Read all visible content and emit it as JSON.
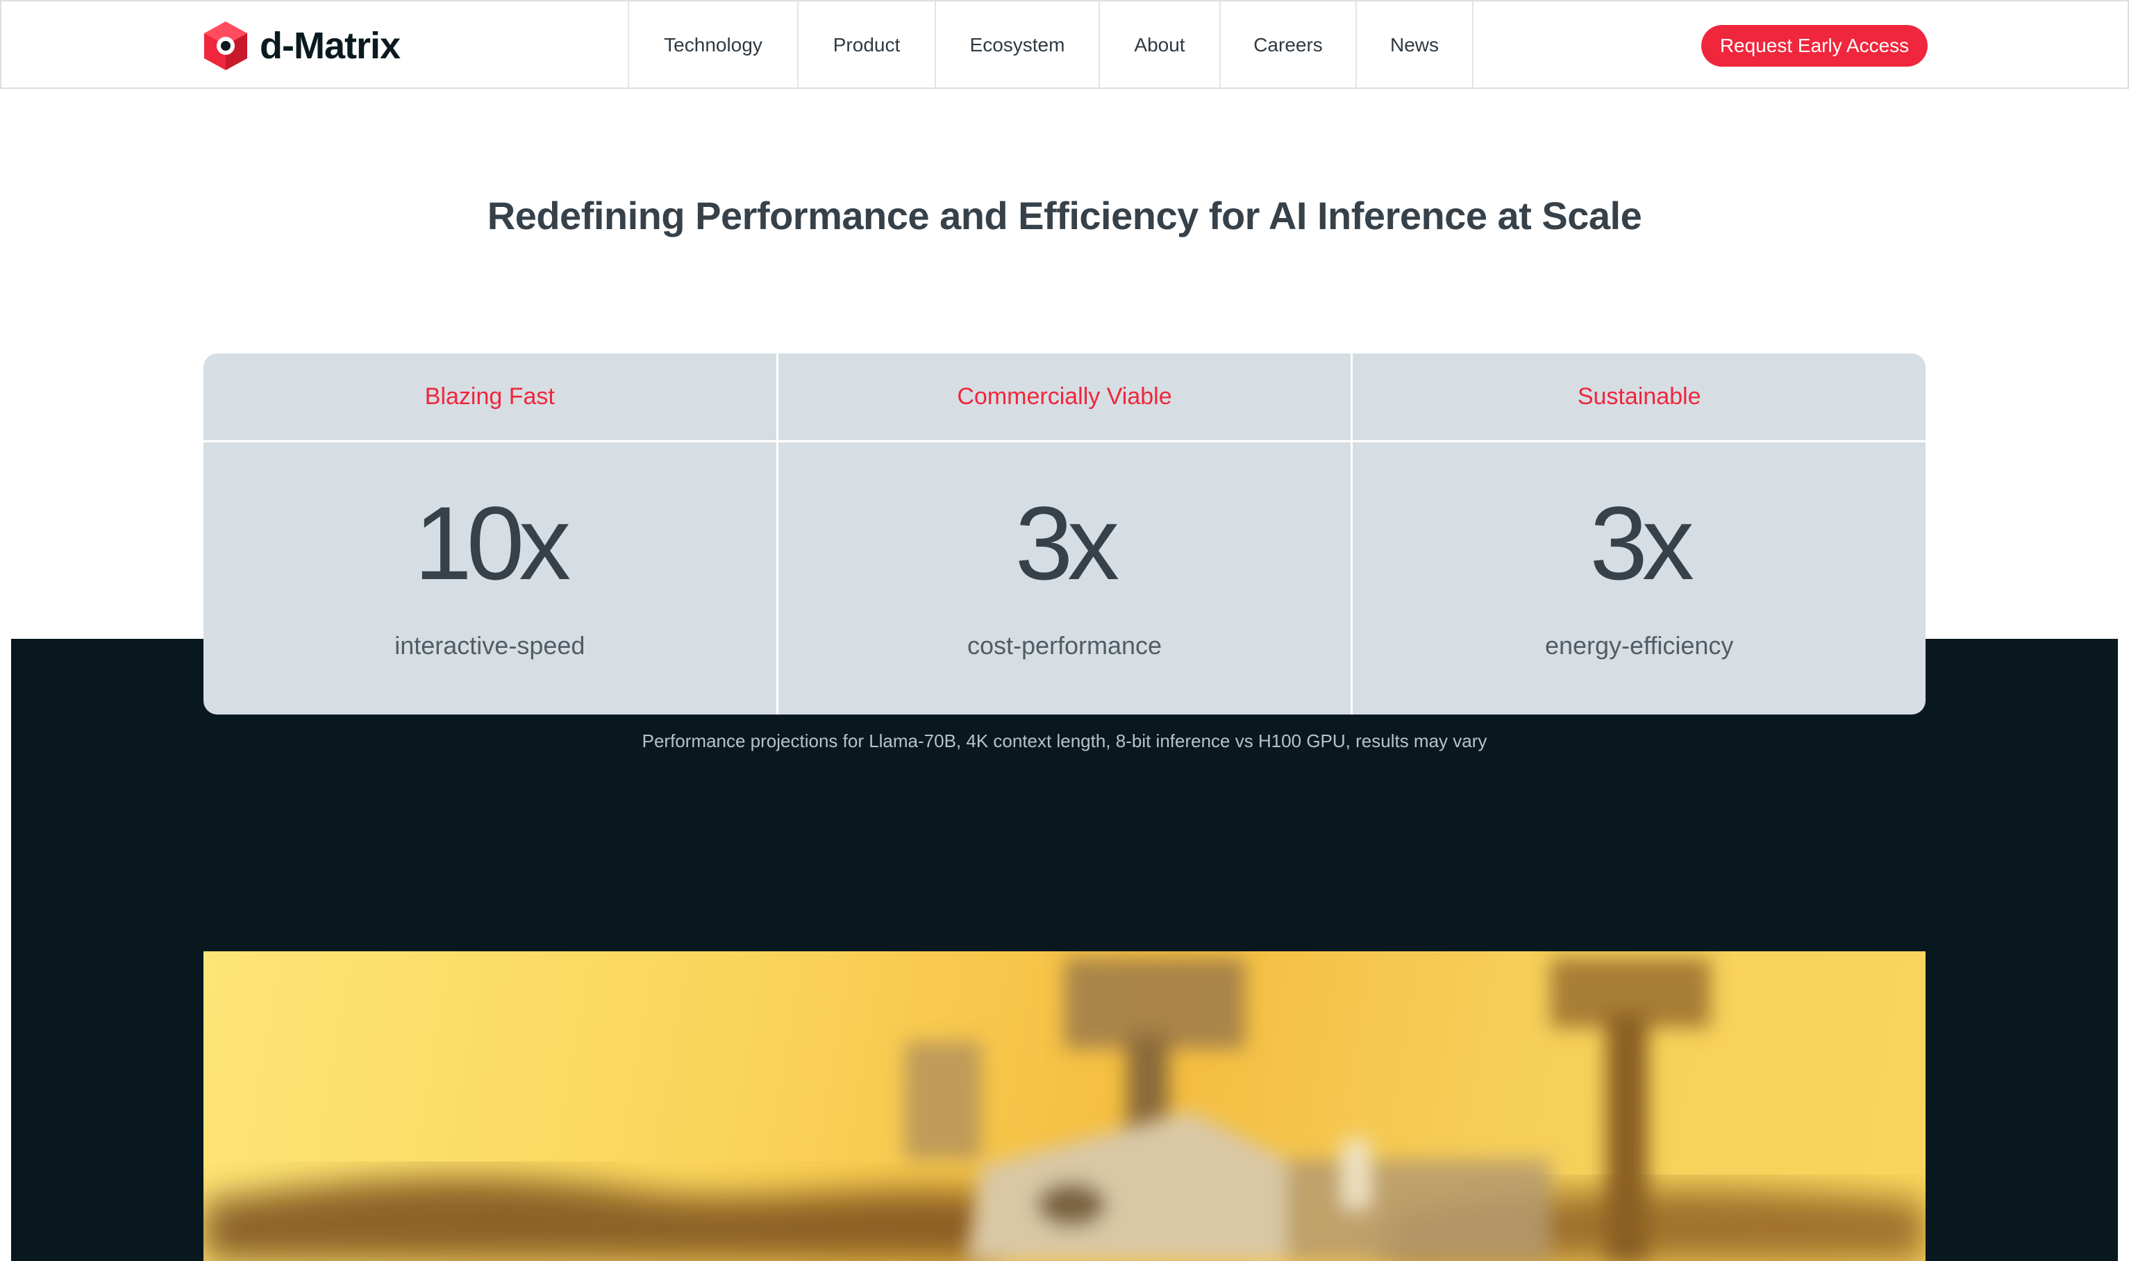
{
  "brand": {
    "name": "d-Matrix",
    "accent": "#f0263c"
  },
  "nav": {
    "items": [
      "Technology",
      "Product",
      "Ecosystem",
      "About",
      "Careers",
      "News"
    ],
    "cta_label": "Request Early Access"
  },
  "headline": "Redefining Performance and Efficiency for AI Inference at Scale",
  "stats": [
    {
      "heading": "Blazing Fast",
      "value": "10x",
      "label": "interactive-speed"
    },
    {
      "heading": "Commercially Viable",
      "value": "3x",
      "label": "cost-performance"
    },
    {
      "heading": "Sustainable",
      "value": "3x",
      "label": "energy-efficiency"
    }
  ],
  "footnote": "Performance projections for Llama-70B, 4K context length, 8-bit inference vs H100 GPU, results may vary"
}
